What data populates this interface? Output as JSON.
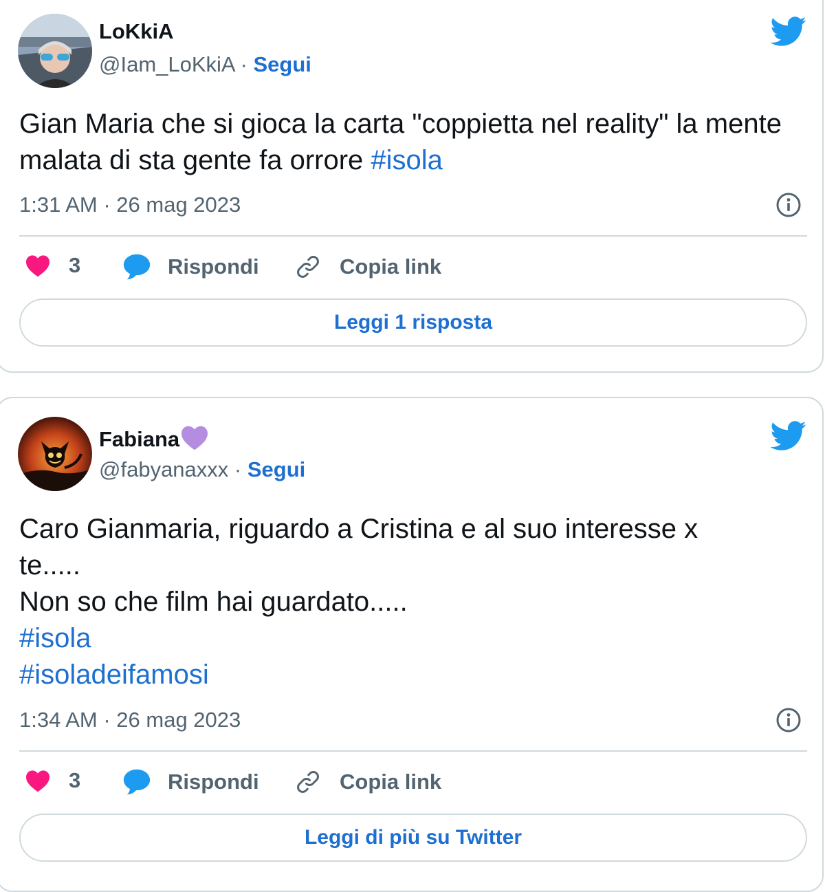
{
  "tweets": [
    {
      "name": "LoKkiA",
      "name_emoji": "",
      "handle": "@Iam_LoKkiA",
      "separator": "·",
      "follow_label": "Segui",
      "text": "Gian Maria che si gioca la carta \"coppietta nel reality\" la mente malata di sta gente fa orrore ",
      "hashtags": [
        "#isola"
      ],
      "timestamp": "1:31 AM · 26 mag 2023",
      "likes": "3",
      "reply_label": "Rispondi",
      "copy_label": "Copia link",
      "footer_button": "Leggi 1 risposta"
    },
    {
      "name": "Fabiana",
      "name_emoji": "purple-heart",
      "handle": "@fabyanaxxx",
      "separator": "·",
      "follow_label": "Segui",
      "text_lines": [
        "Caro Gianmaria, riguardo a Cristina e al suo interesse x",
        "te.....",
        "Non so che film hai guardato....."
      ],
      "hashtags": [
        "#isola",
        "#isoladeifamosi"
      ],
      "timestamp": "1:34 AM · 26 mag 2023",
      "likes": "3",
      "reply_label": "Rispondi",
      "copy_label": "Copia link",
      "footer_button": "Leggi di più su Twitter"
    }
  ],
  "colors": {
    "link": "#1d6fd1",
    "twitter_blue": "#1d9bf0",
    "heart": "#f91880",
    "secondary_text": "#536471",
    "border": "#cfd9de",
    "purple_heart": "#b48de0"
  }
}
